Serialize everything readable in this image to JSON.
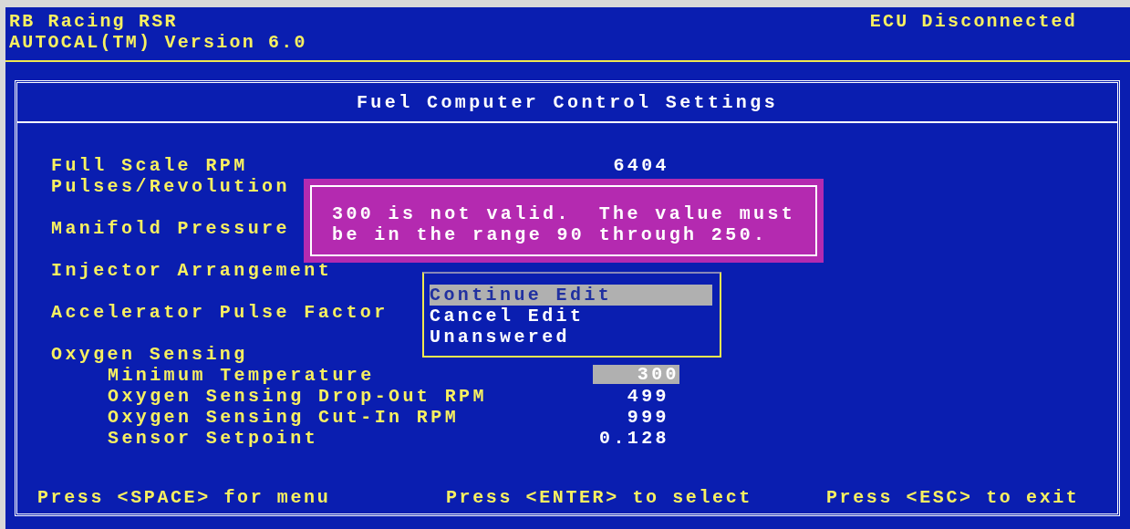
{
  "header": {
    "title": "RB Racing RSR",
    "version": "AUTOCAL(TM) Version 6.0",
    "status": "ECU Disconnected"
  },
  "panel": {
    "title": "Fuel Computer Control Settings",
    "settings": [
      {
        "label": "Full Scale RPM",
        "value": "6404"
      },
      {
        "label": "Pulses/Revolution"
      },
      {
        "label": "Manifold Pressure"
      },
      {
        "label": "Injector Arrangement"
      },
      {
        "label": "Accelerator Pulse Factor"
      },
      {
        "label": "Oxygen Sensing",
        "children": [
          {
            "label": "Minimum Temperature",
            "value": "300",
            "editing": true
          },
          {
            "label": "Oxygen Sensing Drop-Out RPM",
            "value": "499",
            "editing": false
          },
          {
            "label": "Oxygen Sensing Cut-In RPM",
            "value": "999",
            "editing": false
          },
          {
            "label": "Sensor Setpoint",
            "value": "0.128",
            "editing": false
          }
        ]
      }
    ],
    "footer": [
      "Press <SPACE> for menu",
      "Press <ENTER> to select",
      "Press <ESC> to exit"
    ]
  },
  "error_popup": {
    "lines": [
      "300 is not valid.  The value must",
      "be in the range 90 through 250."
    ]
  },
  "menu": {
    "items": [
      {
        "label": "Continue Edit",
        "selected": true
      },
      {
        "label": "Cancel Edit",
        "selected": false
      },
      {
        "label": "Unanswered",
        "selected": false
      }
    ]
  }
}
